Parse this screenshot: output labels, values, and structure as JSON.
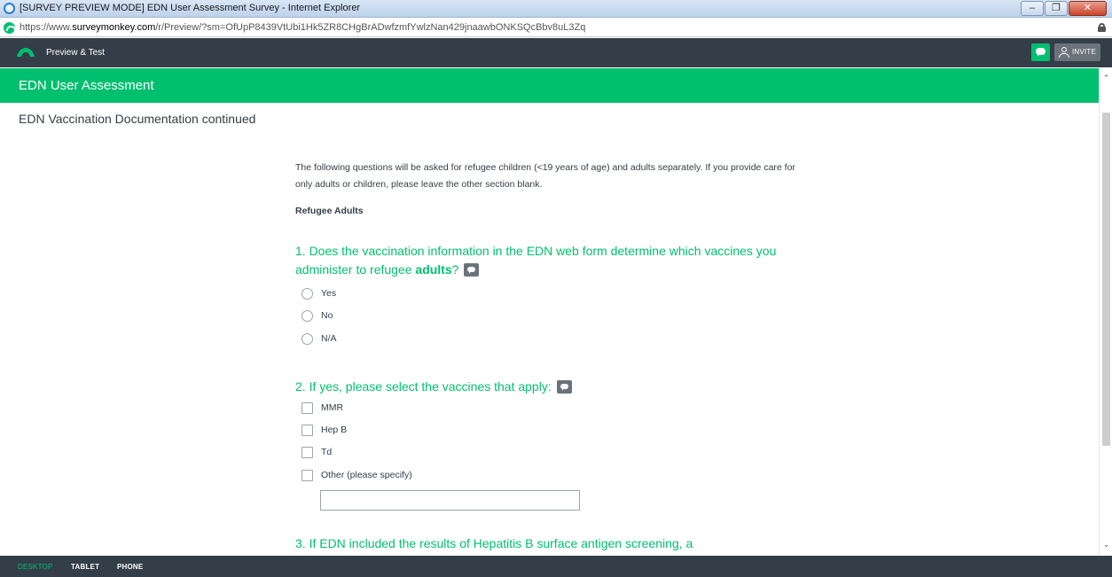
{
  "browser": {
    "window_title": "[SURVEY PREVIEW MODE] EDN User Assessment Survey - Internet Explorer",
    "url_prefix": "https://www.",
    "url_host": "surveymonkey.com",
    "url_path": "/r/Preview/?sm=OfUpP8439VtUbi1Hk5ZR8CHgBrADwfzmfYwlzNan429jnaawbONKSQcBbv8uL3Zq",
    "window_buttons": {
      "minimize": "–",
      "maximize": "❐",
      "close": "✕"
    }
  },
  "preview_bar": {
    "label": "Preview & Test",
    "invite_label": "INVITE"
  },
  "survey": {
    "header_title": "EDN User Assessment",
    "page_title": "EDN Vaccination Documentation continued",
    "intro": "The following questions will be asked for refugee children (<19 years of age) and adults separately. If you provide care for only adults or children, please leave the other section blank.",
    "section_label": "Refugee Adults",
    "questions": [
      {
        "prefix": "1. Does the vaccination information in the EDN web form determine which vaccines you administer to refugee ",
        "emphasis": "adults",
        "suffix": "?",
        "type": "radio",
        "options": [
          "Yes",
          "No",
          "N/A"
        ]
      },
      {
        "text": "2. If yes, please select the vaccines that apply:",
        "type": "checkbox",
        "options": [
          "MMR",
          "Hep B",
          "Td",
          "Other (please specify)"
        ],
        "other_value": ""
      },
      {
        "text": "3. If EDN included the results of Hepatitis B surface antigen screening, a"
      }
    ]
  },
  "device_bar": {
    "desktop": "DESKTOP",
    "tablet": "TABLET",
    "phone": "PHONE",
    "active": "desktop"
  },
  "colors": {
    "brand_green": "#00bf6f",
    "dark_bar": "#333e48",
    "icon_gray": "#6a737b"
  },
  "icons": {
    "browser": "ie-icon",
    "site": "surveymonkey-icon",
    "secure": "lock-icon",
    "logo": "monkey-logo-icon",
    "comment": "comment-icon",
    "invite": "person-icon"
  }
}
